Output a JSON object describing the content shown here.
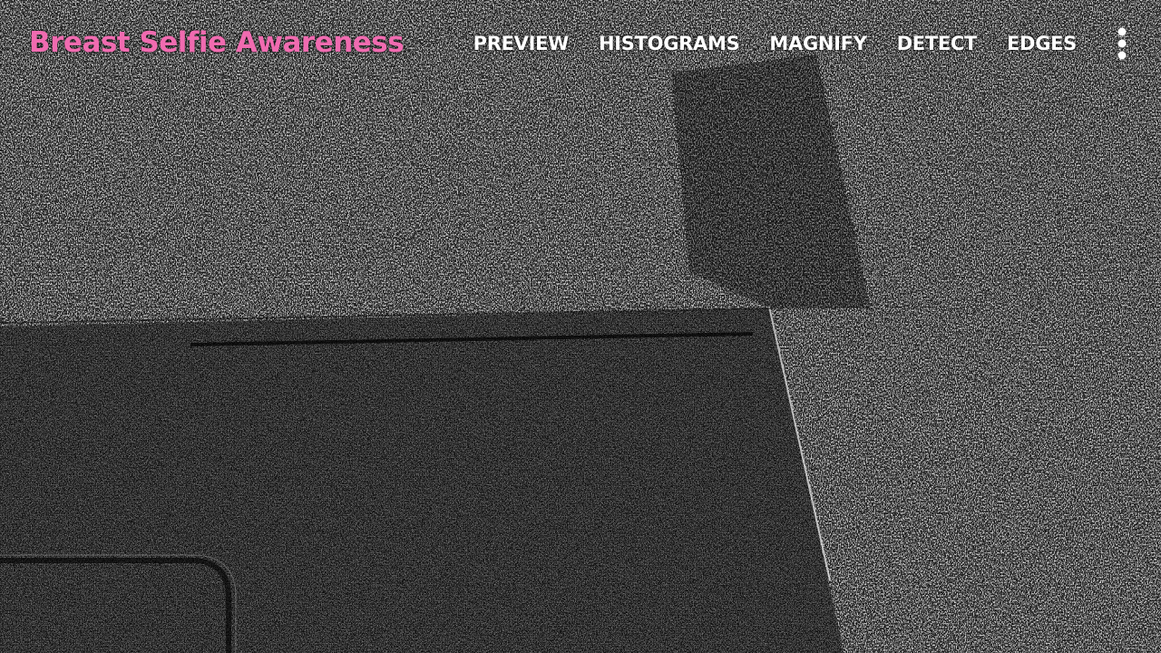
{
  "app": {
    "title": "Breast Selfie Awareness",
    "title_color": "#f06bb0"
  },
  "action_bar": {
    "items": [
      {
        "label": "PREVIEW"
      },
      {
        "label": "HISTOGRAMS"
      },
      {
        "label": "MAGNIFY"
      },
      {
        "label": "DETECT"
      },
      {
        "label": "EDGES"
      }
    ],
    "overflow_icon": "more-vertical-icon"
  },
  "camera_view": {
    "mode": "edge-filtered camera feed",
    "colors": {
      "background": "#111111",
      "noise_light": "#ffffff"
    }
  }
}
